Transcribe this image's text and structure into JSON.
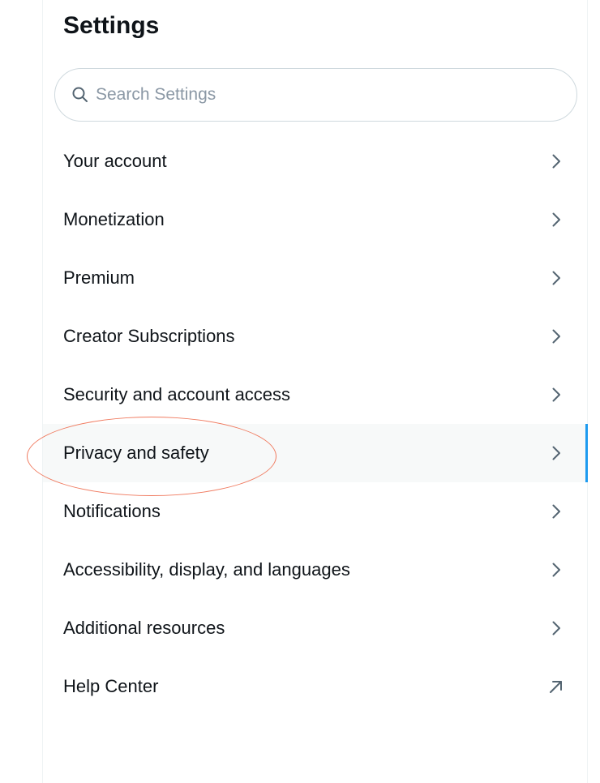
{
  "header": {
    "title": "Settings"
  },
  "search": {
    "placeholder": "Search Settings",
    "value": ""
  },
  "menu": {
    "items": [
      {
        "label": "Your account",
        "icon": "chevron-right-icon"
      },
      {
        "label": "Monetization",
        "icon": "chevron-right-icon"
      },
      {
        "label": "Premium",
        "icon": "chevron-right-icon"
      },
      {
        "label": "Creator Subscriptions",
        "icon": "chevron-right-icon"
      },
      {
        "label": "Security and account access",
        "icon": "chevron-right-icon"
      },
      {
        "label": "Privacy and safety",
        "icon": "chevron-right-icon",
        "active": true
      },
      {
        "label": "Notifications",
        "icon": "chevron-right-icon"
      },
      {
        "label": "Accessibility, display, and languages",
        "icon": "chevron-right-icon"
      },
      {
        "label": "Additional resources",
        "icon": "chevron-right-icon"
      },
      {
        "label": "Help Center",
        "icon": "external-link-arrow-icon"
      }
    ]
  },
  "colors": {
    "accent": "#1d9bf0",
    "active_background": "#f7f9f9",
    "annotation": "#f07a5f",
    "text": "#0f1419",
    "icon": "#536471"
  }
}
